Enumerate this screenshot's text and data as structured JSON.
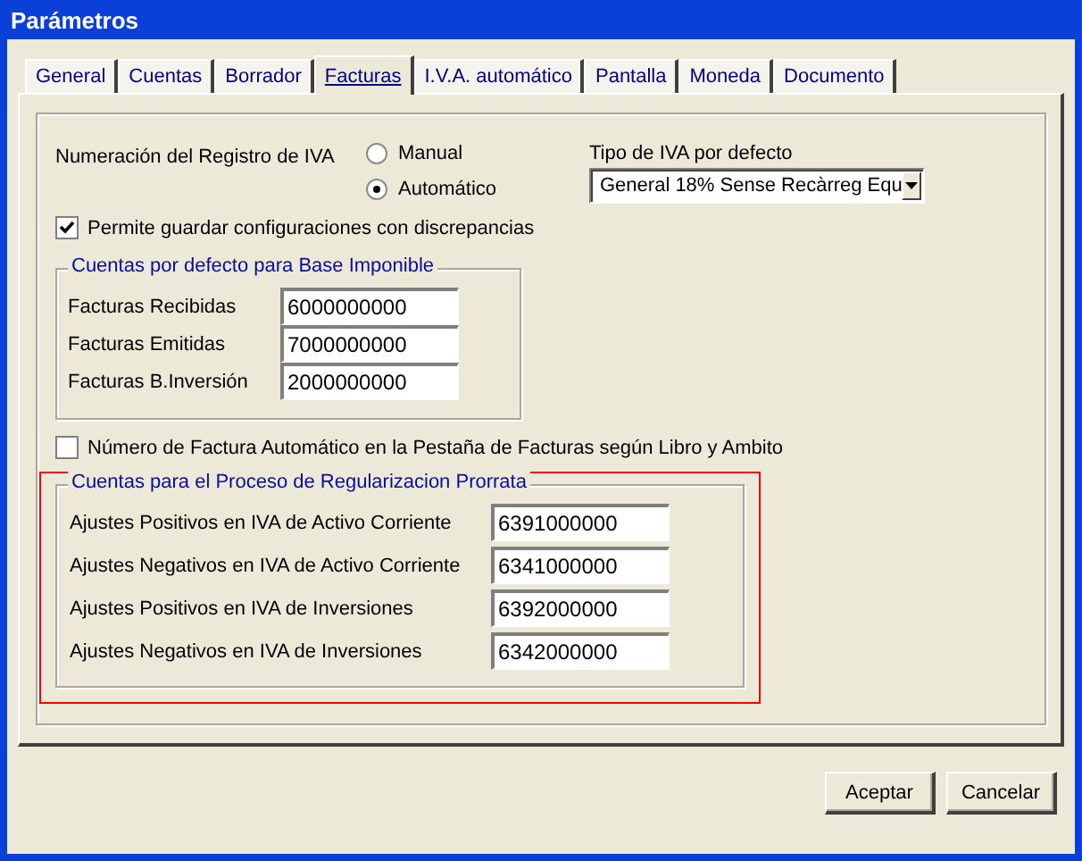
{
  "window": {
    "title": "Parámetros"
  },
  "tabs": [
    {
      "label": "General",
      "selected": false
    },
    {
      "label": "Cuentas",
      "selected": false
    },
    {
      "label": "Borrador",
      "selected": false
    },
    {
      "label": "Facturas",
      "selected": true
    },
    {
      "label": "I.V.A. automático",
      "selected": false
    },
    {
      "label": "Pantalla",
      "selected": false
    },
    {
      "label": "Moneda",
      "selected": false
    },
    {
      "label": "Documento",
      "selected": false
    }
  ],
  "numbering": {
    "label": "Numeración del Registro de IVA",
    "options": [
      {
        "label": "Manual",
        "selected": false
      },
      {
        "label": "Automático",
        "selected": true
      }
    ]
  },
  "default_vat": {
    "label": "Tipo de IVA por defecto",
    "value": "General 18% Sense Recàrreg Equ"
  },
  "allow_discrepancies": {
    "label": "Permite guardar configuraciones con discrepancias",
    "checked": true
  },
  "base_accounts": {
    "title": "Cuentas por defecto para Base Imponible",
    "fields": [
      {
        "label": "Facturas Recibidas",
        "value": "6000000000"
      },
      {
        "label": "Facturas Emitidas",
        "value": "7000000000"
      },
      {
        "label": "Facturas B.Inversión",
        "value": "2000000000"
      }
    ]
  },
  "auto_invoice_number": {
    "label": "Número de Factura Automático en la Pestaña de Facturas según Libro y Ambito",
    "checked": false
  },
  "prorrata_accounts": {
    "title": "Cuentas para el Proceso de Regularizacion Prorrata",
    "fields": [
      {
        "label": "Ajustes Positivos en IVA de Activo Corriente",
        "value": "6391000000"
      },
      {
        "label": "Ajustes Negativos en IVA de Activo Corriente",
        "value": "6341000000"
      },
      {
        "label": "Ajustes Positivos en IVA de Inversiones",
        "value": "6392000000"
      },
      {
        "label": "Ajustes Negativos en IVA de Inversiones",
        "value": "6342000000"
      }
    ]
  },
  "buttons": [
    "Aceptar",
    "Cancelar"
  ]
}
